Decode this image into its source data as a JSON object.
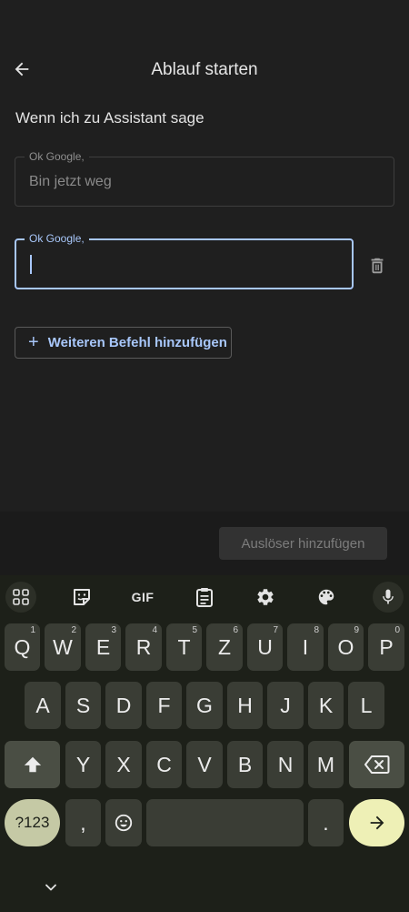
{
  "header": {
    "title": "Ablauf starten"
  },
  "section": {
    "subtitle": "Wenn ich zu Assistant sage"
  },
  "commands": [
    {
      "legend": "Ok Google,",
      "value": "Bin jetzt weg"
    },
    {
      "legend": "Ok Google,",
      "value": ""
    }
  ],
  "actions": {
    "add_command_plus": "+",
    "add_command_label": "Weiteren Befehl hinzufügen",
    "add_trigger_label": "Auslöser hinzufügen"
  },
  "keyboard": {
    "toolbar": {
      "gif_label": "GIF"
    },
    "row1": [
      {
        "char": "Q",
        "hint": "1"
      },
      {
        "char": "W",
        "hint": "2"
      },
      {
        "char": "E",
        "hint": "3"
      },
      {
        "char": "R",
        "hint": "4"
      },
      {
        "char": "T",
        "hint": "5"
      },
      {
        "char": "Z",
        "hint": "6"
      },
      {
        "char": "U",
        "hint": "7"
      },
      {
        "char": "I",
        "hint": "8"
      },
      {
        "char": "O",
        "hint": "9"
      },
      {
        "char": "P",
        "hint": "0"
      }
    ],
    "row2": [
      "A",
      "S",
      "D",
      "F",
      "G",
      "H",
      "J",
      "K",
      "L"
    ],
    "row3": [
      "Y",
      "X",
      "C",
      "V",
      "B",
      "N",
      "M"
    ],
    "symbols_label": "?123",
    "comma": ",",
    "period": "."
  },
  "colors": {
    "accent": "#a8c7fa",
    "enter_key": "#eef0b6",
    "symbols_key": "#c5c9a5"
  }
}
